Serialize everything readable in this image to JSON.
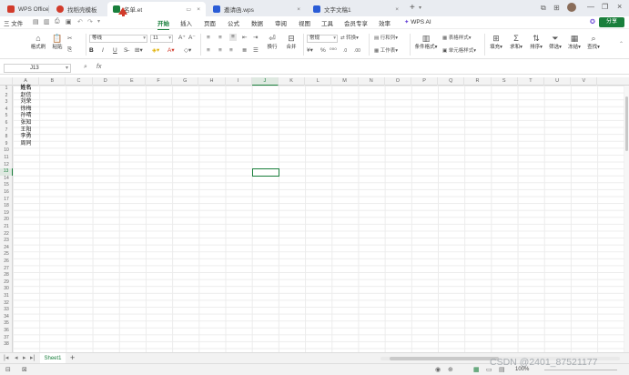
{
  "tabs": [
    {
      "label": "WPS Office",
      "color": "#d23b2b"
    },
    {
      "label": "找稻壳模板",
      "color": "#d23b2b"
    },
    {
      "label": "名单.et",
      "color": "#1a7f3c"
    },
    {
      "label": "邀请函.wps",
      "color": "#2a5cd6"
    },
    {
      "label": "文字文稿1",
      "color": "#2a5cd6"
    }
  ],
  "menu": {
    "file": "三 文件",
    "items": [
      "开始",
      "插入",
      "页面",
      "公式",
      "数据",
      "审阅",
      "视图",
      "工具",
      "会员专享",
      "效率"
    ],
    "wps_ai": "WPS AI",
    "share": "分享"
  },
  "ribbon": {
    "format_painter": "格式刷",
    "paste": "粘贴",
    "cut": "",
    "font_name": "等线",
    "font_size": "11",
    "bold": "B",
    "italic": "I",
    "underline": "U",
    "wrap": "换行",
    "merge": "合并",
    "num_format": "常规",
    "convert": "转换",
    "row_col": "行和列",
    "worksheet": "工作表",
    "cond_format": "条件格式",
    "cell_style": "单元格样式",
    "table_style": "表格样式",
    "fill": "填充",
    "sum": "求和",
    "sort": "排序",
    "filter": "筛选",
    "freeze": "冻结",
    "find": "查找"
  },
  "formula_bar": {
    "cell_ref": "J13",
    "fx": "fx",
    "value": ""
  },
  "columns": [
    "A",
    "B",
    "C",
    "D",
    "E",
    "F",
    "G",
    "H",
    "I",
    "J",
    "K",
    "L",
    "M",
    "N",
    "O",
    "P",
    "Q",
    "R",
    "S",
    "T",
    "U",
    "V"
  ],
  "active_cell": {
    "col": "J",
    "row": "13"
  },
  "rows": [
    "1",
    "2",
    "3",
    "4",
    "5",
    "6",
    "7",
    "8",
    "9",
    "10",
    "11",
    "12",
    "13",
    "14",
    "15",
    "16",
    "17",
    "18",
    "19",
    "20",
    "21",
    "22",
    "23",
    "24",
    "25",
    "26",
    "27",
    "28",
    "29",
    "30",
    "31",
    "32",
    "33",
    "34",
    "35",
    "36",
    "37",
    "38"
  ],
  "cells": [
    "姓名",
    "赵信",
    "刘荣",
    "徐梅",
    "孙晴",
    "张知",
    "王阳",
    "李勇",
    "周同"
  ],
  "sheet_tab": "Sheet1",
  "add_sheet": "+",
  "status": {
    "zoom": "100%"
  },
  "watermark": "CSDN @2401_87521177"
}
